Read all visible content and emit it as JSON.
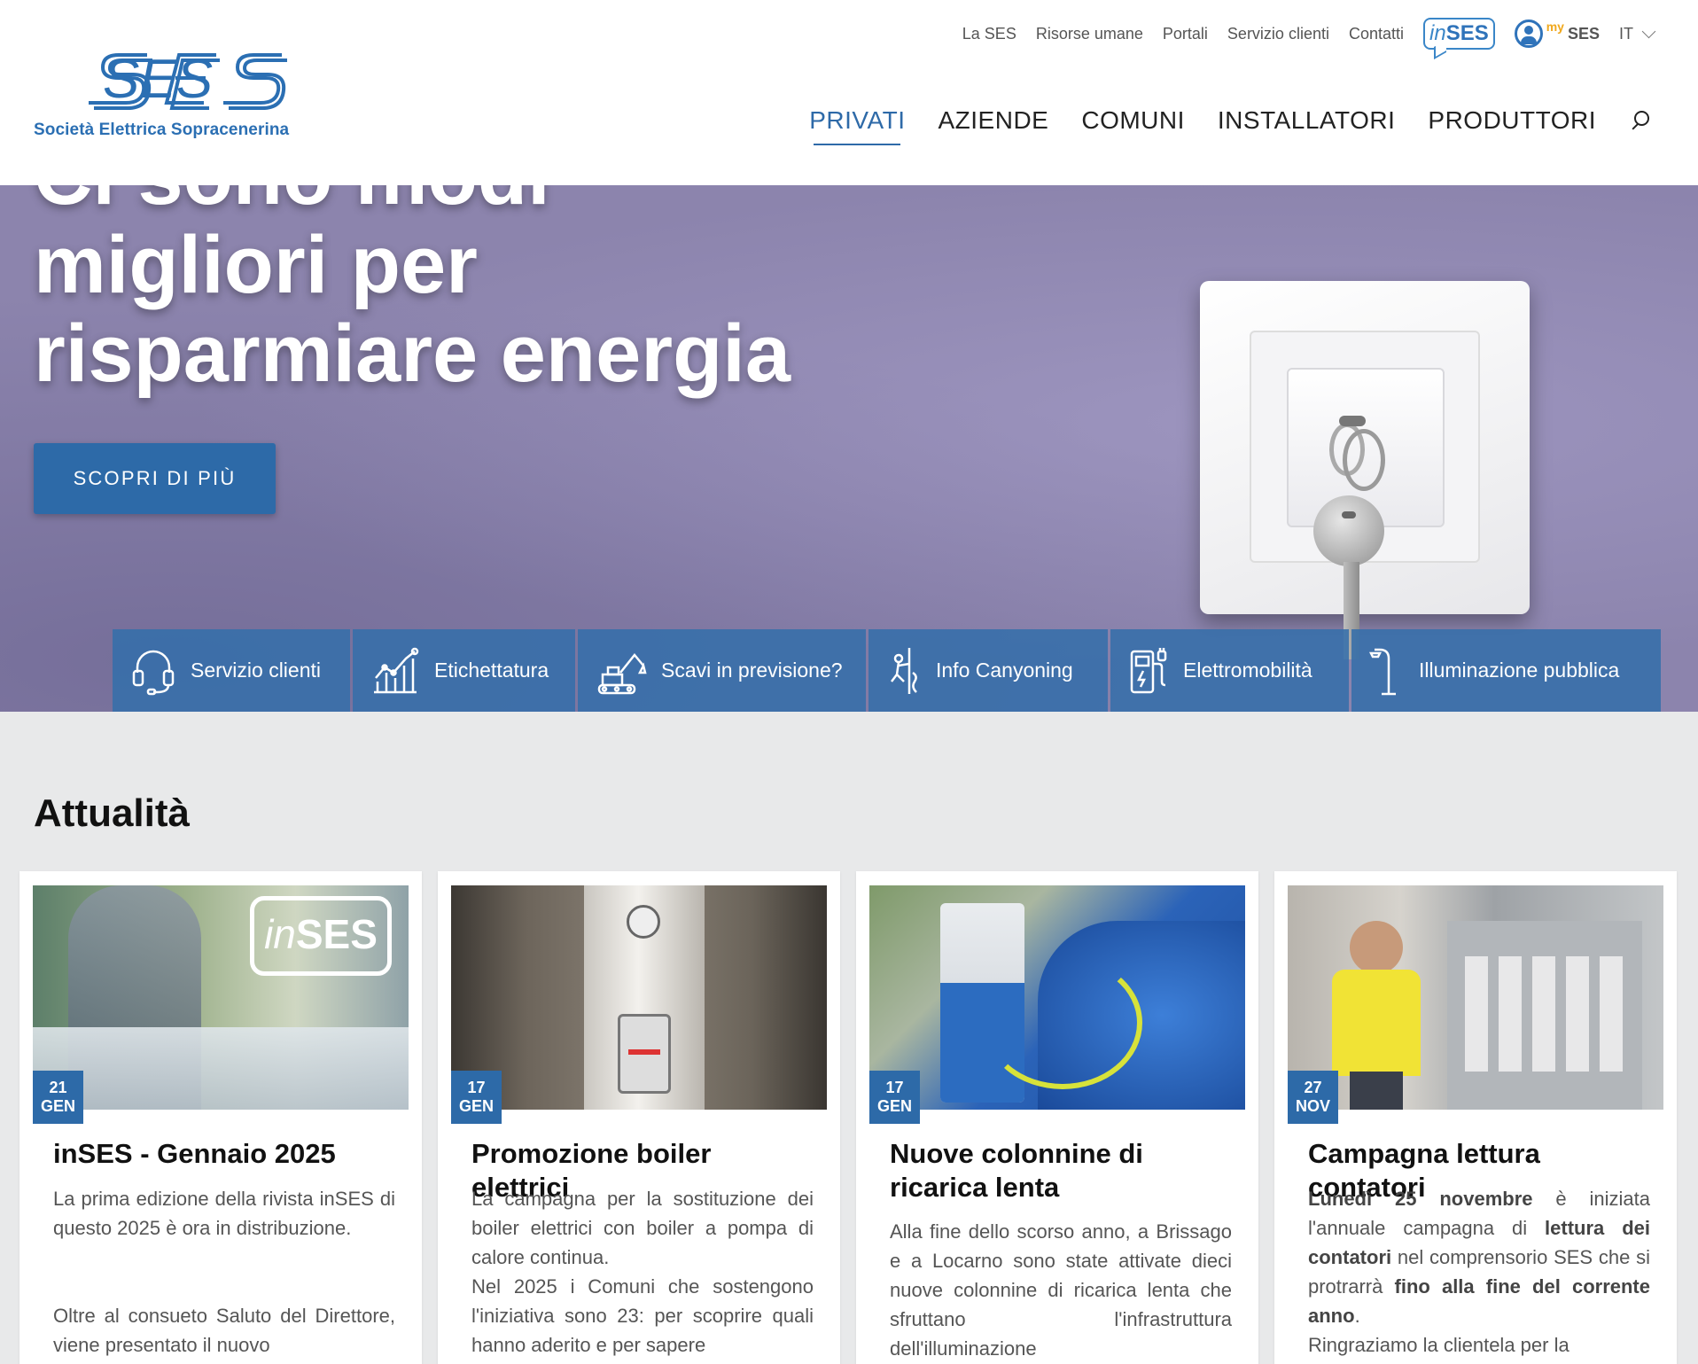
{
  "brand": {
    "name": "SES",
    "tagline": "Società Elettrica Sopracenerina"
  },
  "topnav": {
    "items": [
      "La SES",
      "Risorse umane",
      "Portali",
      "Servizio clienti",
      "Contatti"
    ],
    "inses": {
      "prefix": "in",
      "suffix": "SES"
    },
    "myses": {
      "prefix": "my",
      "suffix": "SES"
    },
    "language": "IT"
  },
  "mainnav": {
    "items": [
      "PRIVATI",
      "AZIENDE",
      "COMUNI",
      "INSTALLATORI",
      "PRODUTTORI"
    ],
    "active": "PRIVATI"
  },
  "hero": {
    "title": "Ci sono modi migliori per risparmiare energia",
    "cta": "SCOPRI DI PIÙ"
  },
  "quicklinks": [
    {
      "label": "Servizio clienti",
      "icon": "headset-icon"
    },
    {
      "label": "Etichettatura",
      "icon": "chart-growth-icon"
    },
    {
      "label": "Scavi in previsione?",
      "icon": "excavator-icon"
    },
    {
      "label": "Info Canyoning",
      "icon": "canyoning-icon"
    },
    {
      "label": "Elettromobilità",
      "icon": "charging-station-icon"
    },
    {
      "label": "Illuminazione pubblica",
      "icon": "streetlight-icon"
    }
  ],
  "news": {
    "title": "Attualità",
    "cards": [
      {
        "day": "21",
        "month": "GEN",
        "title": "inSES - Gennaio 2025",
        "body1": "La prima edizione della rivista inSES di questo 2025 è ora in distribuzione.",
        "body2": "Oltre al consueto Saluto del Direttore, viene presentato il nuovo"
      },
      {
        "day": "17",
        "month": "GEN",
        "title": "Promozione boiler elettrici",
        "body1": "La campagna per la sostituzione dei boiler elettrici con boiler a pompa di calore continua.",
        "body2": "Nel 2025 i Comuni che sostengono l'iniziativa sono 23: per scoprire quali hanno aderito e per sapere"
      },
      {
        "day": "17",
        "month": "GEN",
        "title": "Nuove colonnine di ricarica lenta",
        "body1": "Alla fine dello scorso anno, a Brissago e a Locarno sono state attivate dieci nuove colonnine di ricarica lenta che sfruttano l'infrastruttura dell'illuminazione"
      },
      {
        "day": "27",
        "month": "NOV",
        "title": "Campagna lettura contatori",
        "b_day": "Lunedì 25 novembre",
        "t1": " è iniziata l'annuale campagna di ",
        "b_read": "lettura dei contatori",
        "t2": " nel comprensorio SES che si protrarrà ",
        "b_end": "fino alla fine del corrente anno",
        "t3": ".",
        "body2": "Ringraziamo la clientela per la"
      }
    ]
  },
  "colors": {
    "accent": "#2d6aa8",
    "hero_bg": "#8c84ad",
    "page_bg": "#e8e9ea"
  }
}
